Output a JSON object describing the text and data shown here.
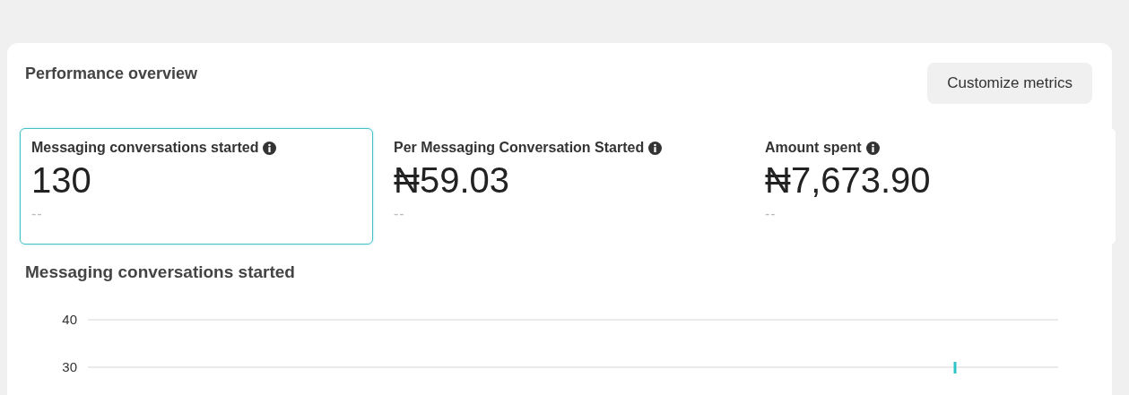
{
  "panel": {
    "title": "Performance overview",
    "customize_button": "Customize metrics"
  },
  "metrics": [
    {
      "label": "Messaging conversations started",
      "value": "130",
      "comparison": "--",
      "selected": true
    },
    {
      "label": "Per Messaging Conversation Started",
      "value": "₦59.03",
      "comparison": "--",
      "selected": false
    },
    {
      "label": "Amount spent",
      "value": "₦7,673.90",
      "comparison": "--",
      "selected": false
    }
  ],
  "chart": {
    "title": "Messaging conversations started",
    "y_axis_labels": [
      "40",
      "30"
    ]
  }
}
